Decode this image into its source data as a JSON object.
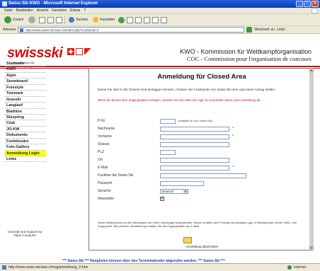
{
  "window": {
    "title": "Swiss-Ski KWO - Microsoft Internet Explorer",
    "controls": {
      "minimize": "_",
      "maximize": "□",
      "close": "×"
    }
  },
  "menubar": [
    "Datei",
    "Bearbeiten",
    "Ansicht",
    "Favoriten",
    "Extras",
    "?"
  ],
  "toolbar": {
    "back_label": "Zurück",
    "search_label": "Suchen",
    "favorites_label": "Favoriten"
  },
  "addressbar": {
    "label": "Adresse",
    "url": "http://www.swiss-ski-kwo.ch/index.php?ContactId=0",
    "go_label": "Wechseln zu",
    "links_label": "Links"
  },
  "header": {
    "logo_text": "swissski",
    "logo_tagline": "Kommission für Wettkampforganisation",
    "title": "KWO - Kommission für Wettkampforganisation",
    "subtitle": "COC - Commission pour l'organisation de concours"
  },
  "sidebar": {
    "items": [
      "Startseite",
      "KWO",
      "Alpin",
      "Snowboard",
      "Freestyle",
      "Telemark",
      "Grasski",
      "Langlauf",
      "Biathlon",
      "Skispring",
      "Club",
      "JO-KW",
      "Dokumente",
      "Funktionäre",
      "Foto-Gallery",
      "Anmeldung Login",
      "Links"
    ],
    "active_index": 15,
    "footer": "Concept and Support by Value Computer"
  },
  "form": {
    "title": "Anmeldung für Closed Area",
    "intro": "Damit Sie sich in die Closed Area einloggen können, müssen Sie Funktionär von Swiss-Ski sein und einen Antrag stellen.",
    "warning": "Wenn Sie bereits über Zugangsdaten verfügen, wenden Sie sich bitte mit Login an und stellen keine neue Anmeldung ab.",
    "fields": [
      {
        "label": "P-Nr",
        "hint": "(Mitglied-Nr von Swiss-Ski)"
      },
      {
        "label": "Nachname",
        "required": "*"
      },
      {
        "label": "Vorname",
        "required": "*"
      },
      {
        "label": "Strasse"
      },
      {
        "label": "PLZ"
      },
      {
        "label": "Ort"
      },
      {
        "label": "E-Mail",
        "required": "*"
      },
      {
        "label": "Funktion bei Swiss-Ski"
      },
      {
        "label": "Passwort"
      }
    ],
    "language_label": "Sprache",
    "language_value": "Deutsch",
    "newsletter_label": "Newsletter",
    "newsletter_checked": "✔",
    "footnote": "Diese Meldung wird an den Webmaster der KWO-Homepage weitergeleitet. Dieser erhaltet nach Prüfung des Antrages, ggf. in Rücksprache mit der KWO, den Zugang frei. Bei positiver Verarbeitung erhalten Sie die Zugangsdaten per E-Mail.",
    "submit_label": "Anmeldung abschicken"
  },
  "ticker": "*** Swiss-Ski ***     Ranglisten können über den Terminkalender abgerufen werden.     *** Swiss-Ski ***",
  "statusbar": {
    "url": "http://www.swiss-ski-kwo.ch/rug/anmeldung_X.htm",
    "zone": "Internet"
  }
}
